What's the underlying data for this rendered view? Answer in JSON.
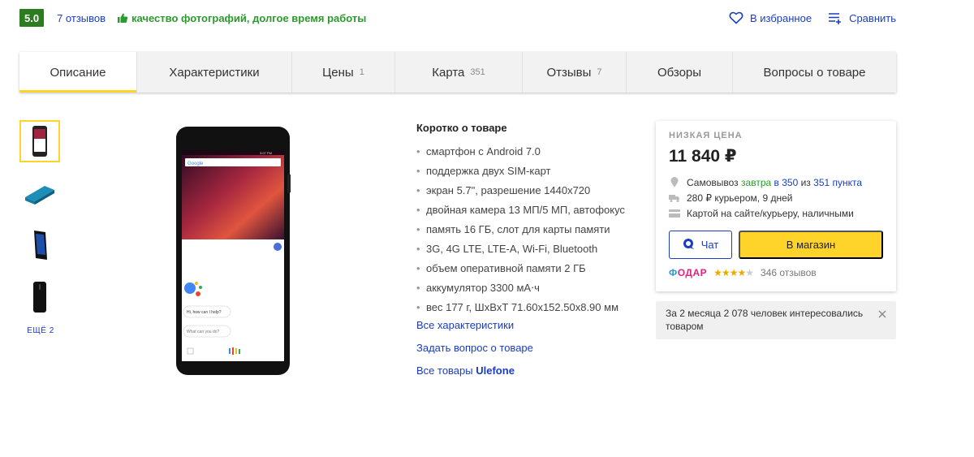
{
  "topbar": {
    "rating": "5.0",
    "reviews_link": "7 отзывов",
    "highlights": "качество фотографий, долгое время работы",
    "favorite_label": "В избранное",
    "compare_label": "Сравнить"
  },
  "tabs": [
    {
      "label": "Описание",
      "count": ""
    },
    {
      "label": "Характеристики",
      "count": ""
    },
    {
      "label": "Цены",
      "count": "1"
    },
    {
      "label": "Карта",
      "count": "351"
    },
    {
      "label": "Отзывы",
      "count": "7"
    },
    {
      "label": "Обзоры",
      "count": ""
    },
    {
      "label": "Вопросы о товаре",
      "count": ""
    }
  ],
  "gallery": {
    "more_label": "ЕЩЁ 2",
    "phone_screen": {
      "search_brand": "Google",
      "status_time": "3:07 PM",
      "assistant_greeting": "Hi, how can I help?",
      "assistant_suggestion": "What can you do?"
    }
  },
  "summary": {
    "title": "Коротко о товаре",
    "features": [
      "смартфон с Android 7.0",
      "поддержка двух SIM-карт",
      "экран 5.7\", разрешение 1440x720",
      "двойная камера 13 МП/5 МП, автофокус",
      "память 16 ГБ, слот для карты памяти",
      "3G, 4G LTE, LTE-A, Wi-Fi, Bluetooth",
      "объем оперативной памяти 2 ГБ",
      "аккумулятор 3300 мА⋅ч",
      "вес 177 г, ШxВxТ 71.60x152.50x8.90 мм"
    ],
    "all_specs_link": "Все характеристики",
    "ask_question_link": "Задать вопрос о товаре",
    "all_goods_prefix": "Все товары",
    "brand": "Ulefone"
  },
  "offer": {
    "label": "НИЗКАЯ ЦЕНА",
    "price": "11 840 ₽",
    "pickup_prefix": "Самовывоз",
    "pickup_when": "завтра",
    "pickup_in": "в 350",
    "pickup_of": "из",
    "pickup_points": "351 пункта",
    "delivery": "280 ₽ курьером, 9 дней",
    "payment": "Картой на сайте/курьеру, наличными",
    "chat_label": "Чат",
    "shop_button_label": "В магазин",
    "shop_name": "ФОДАР",
    "shop_name_first_letter": "Ф",
    "shop_name_rest": "ОДАР",
    "shop_rating": 4,
    "shop_reviews": "346 отзывов"
  },
  "note": {
    "text": "За 2 месяца 2 078 человек интересовались товаром"
  },
  "colors": {
    "accent_yellow": "#fed42b",
    "link_blue": "#1a3dc1",
    "rating_green": "#2c7c20",
    "highlight_green": "#2c9a2c"
  }
}
